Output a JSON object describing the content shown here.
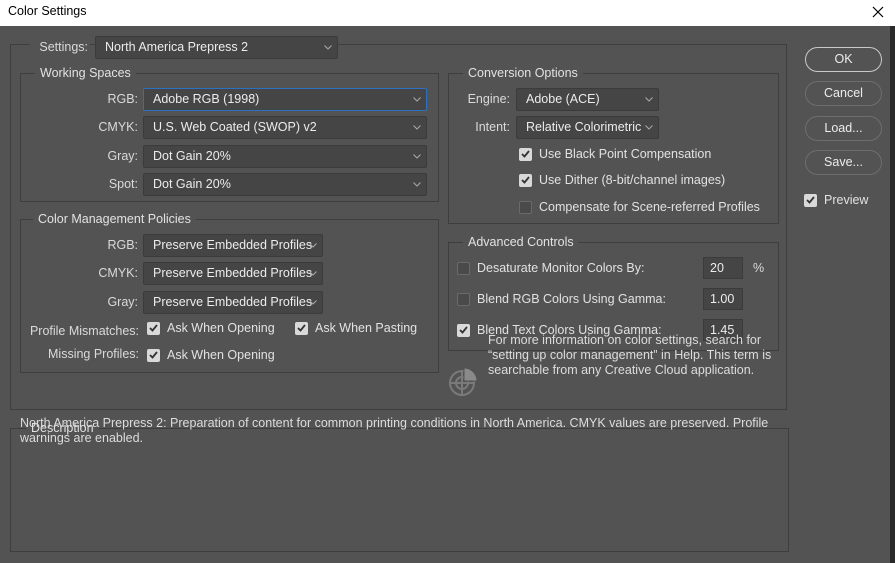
{
  "window": {
    "title": "Color Settings",
    "close_icon": "close-icon"
  },
  "settings": {
    "label": "Settings:",
    "value": "North America Prepress 2"
  },
  "working_spaces": {
    "title": "Working Spaces",
    "rows": [
      {
        "label": "RGB:",
        "value": "Adobe RGB (1998)"
      },
      {
        "label": "CMYK:",
        "value": "U.S. Web Coated (SWOP) v2"
      },
      {
        "label": "Gray:",
        "value": "Dot Gain 20%"
      },
      {
        "label": "Spot:",
        "value": "Dot Gain 20%"
      }
    ]
  },
  "policies": {
    "title": "Color Management Policies",
    "rows": [
      {
        "label": "RGB:",
        "value": "Preserve Embedded Profiles"
      },
      {
        "label": "CMYK:",
        "value": "Preserve Embedded Profiles"
      },
      {
        "label": "Gray:",
        "value": "Preserve Embedded Profiles"
      }
    ],
    "profile_mismatches": {
      "label": "Profile Mismatches:",
      "ask_opening": {
        "label": "Ask When Opening",
        "checked": true
      },
      "ask_pasting": {
        "label": "Ask When Pasting",
        "checked": true
      }
    },
    "missing_profiles": {
      "label": "Missing Profiles:",
      "ask_opening": {
        "label": "Ask When Opening",
        "checked": true
      }
    }
  },
  "conversion": {
    "title": "Conversion Options",
    "engine": {
      "label": "Engine:",
      "value": "Adobe (ACE)"
    },
    "intent": {
      "label": "Intent:",
      "value": "Relative Colorimetric"
    },
    "checks": [
      {
        "label": "Use Black Point Compensation",
        "checked": true
      },
      {
        "label": "Use Dither (8-bit/channel images)",
        "checked": true
      },
      {
        "label": "Compensate for Scene-referred Profiles",
        "checked": false
      }
    ]
  },
  "advanced": {
    "title": "Advanced Controls",
    "rows": [
      {
        "label": "Desaturate Monitor Colors By:",
        "checked": false,
        "value": "20",
        "unit": "%"
      },
      {
        "label": "Blend RGB Colors Using Gamma:",
        "checked": false,
        "value": "1.00"
      },
      {
        "label": "Blend Text Colors Using Gamma:",
        "checked": true,
        "value": "1.45"
      }
    ]
  },
  "info": {
    "icon": "color-wheel-icon",
    "text": "For more information on color settings, search for “setting up color management” in Help. This term is searchable from any Creative Cloud application."
  },
  "description": {
    "title": "Description",
    "text": "North America Prepress 2:  Preparation of content for common printing conditions in North America. CMYK values are preserved. Profile warnings are enabled."
  },
  "buttons": {
    "ok": "OK",
    "cancel": "Cancel",
    "load": "Load...",
    "save": "Save..."
  },
  "preview": {
    "label": "Preview",
    "checked": true
  },
  "colors": {
    "background": "#535353",
    "focus_border": "#2d6fc0",
    "field_bg": "#454545"
  }
}
